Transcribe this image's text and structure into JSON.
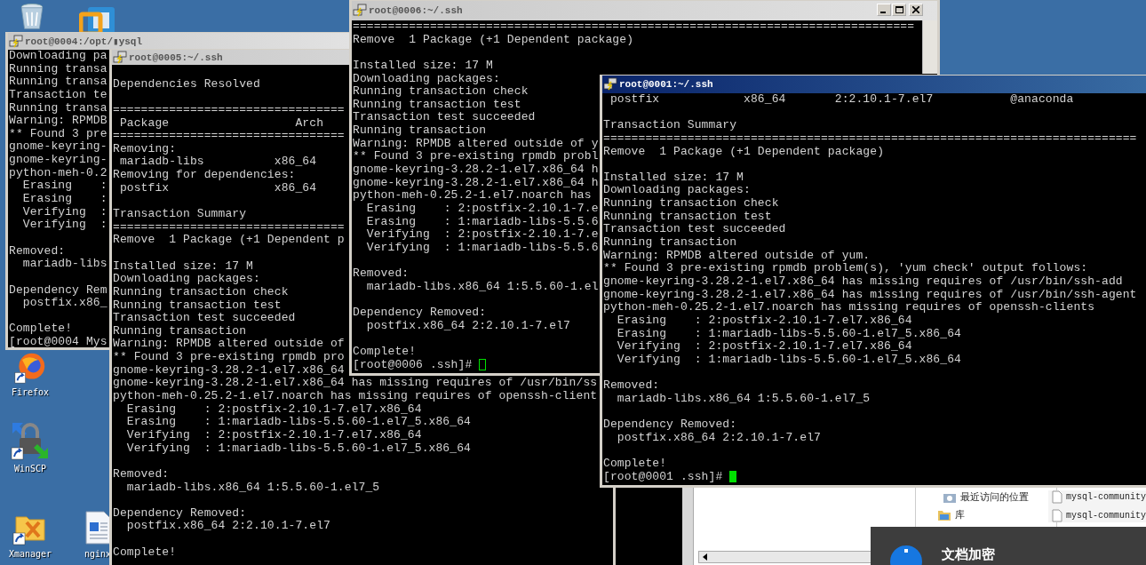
{
  "desktop_icons": [
    {
      "kind": "recycle_bin"
    },
    {
      "kind": "squares"
    },
    {
      "kind": "browser",
      "label": "Firefox"
    },
    {
      "kind": "padlock",
      "label": "WinSCP"
    },
    {
      "kind": "folder",
      "label": "Xmanager"
    },
    {
      "kind": "document",
      "label": "nginx"
    }
  ],
  "windows": [
    {
      "title": "root@0004:/opt/▮ysql",
      "active": false,
      "has_controls": false,
      "blocks": [
        [
          "Downloading pa",
          "Running transa",
          "Running transa",
          "Transaction te",
          "Running transa",
          "Warning: RPMDB",
          "** Found 3 pre",
          "gnome-keyring-",
          "gnome-keyring-",
          "python-meh-0.2",
          "  Erasing    :",
          "  Erasing    :",
          "  Verifying  :",
          "  Verifying  :"
        ],
        [
          "Removed:",
          "  mariadb-libs"
        ],
        [
          "Dependency Rem",
          "  postfix.x86_"
        ],
        [
          "Complete!",
          "[root@0004 Mys"
        ]
      ]
    },
    {
      "title": "root@0005:~/.ssh",
      "active": false,
      "blocks": [
        [
          "Dependencies Resolved"
        ],
        [
          "=================================",
          " Package                  Arch",
          "=================================",
          "Removing:",
          " mariadb-libs          x86_64",
          "Removing for dependencies:",
          " postfix               x86_64"
        ],
        [
          "Transaction Summary",
          "=================================",
          "Remove  1 Package (+1 Dependent p"
        ],
        [
          "Installed size: 17 M",
          "Downloading packages:",
          "Running transaction check",
          "Running transaction test",
          "Transaction test succeeded",
          "Running transaction",
          "Warning: RPMDB altered outside of",
          "** Found 3 pre-existing rpmdb pro",
          "gnome-keyring-3.28.2-1.el7.x86_64",
          "gnome-keyring-3.28.2-1.el7.x86_64 has missing requires of /usr/bin/ss",
          "python-meh-0.25.2-1.el7.noarch has missing requires of openssh-client",
          "  Erasing    : 2:postfix-2.10.1-7.el7.x86_64",
          "  Erasing    : 1:mariadb-libs-5.5.60-1.el7_5.x86_64",
          "  Verifying  : 2:postfix-2.10.1-7.el7.x86_64",
          "  Verifying  : 1:mariadb-libs-5.5.60-1.el7_5.x86_64"
        ],
        [
          "Removed:",
          "  mariadb-libs.x86_64 1:5.5.60-1.el7_5"
        ],
        [
          "Dependency Removed:",
          "  postfix.x86_64 2:2.10.1-7.el7"
        ],
        [
          "Complete!"
        ]
      ]
    },
    {
      "title": "root@0006:~/.ssh",
      "active": false,
      "has_controls": true,
      "cursor": true,
      "blocks": [
        [
          "================================================================================",
          "Remove  1 Package (+1 Dependent package)"
        ],
        [
          "Installed size: 17 M",
          "Downloading packages:",
          "Running transaction check",
          "Running transaction test",
          "Transaction test succeeded",
          "Running transaction",
          "Warning: RPMDB altered outside of y",
          "** Found 3 pre-existing rpmdb probl",
          "gnome-keyring-3.28.2-1.el7.x86_64 h",
          "gnome-keyring-3.28.2-1.el7.x86_64 h",
          "python-meh-0.25.2-1.el7.noarch has",
          "  Erasing    : 2:postfix-2.10.1-7.e",
          "  Erasing    : 1:mariadb-libs-5.5.6",
          "  Verifying  : 2:postfix-2.10.1-7.e",
          "  Verifying  : 1:mariadb-libs-5.5.6"
        ],
        [
          "Removed:",
          "  mariadb-libs.x86_64 1:5.5.60-1.el"
        ],
        [
          "Dependency Removed:",
          "  postfix.x86_64 2:2.10.1-7.el7"
        ],
        [
          "Complete!",
          "[root@0006 .ssh]#"
        ]
      ]
    },
    {
      "title": "root@0001:~/.ssh",
      "active": true,
      "has_controls": false,
      "cursor": true,
      "blocks": [
        [
          " postfix            x86_64       2:2.10.1-7.el7           @anaconda"
        ],
        [
          "Transaction Summary",
          "============================================================================",
          "Remove  1 Package (+1 Dependent package)"
        ],
        [
          "Installed size: 17 M",
          "Downloading packages:",
          "Running transaction check",
          "Running transaction test",
          "Transaction test succeeded",
          "Running transaction",
          "Warning: RPMDB altered outside of yum.",
          "** Found 3 pre-existing rpmdb problem(s), 'yum check' output follows:",
          "gnome-keyring-3.28.2-1.el7.x86_64 has missing requires of /usr/bin/ssh-add",
          "gnome-keyring-3.28.2-1.el7.x86_64 has missing requires of /usr/bin/ssh-agent",
          "python-meh-0.25.2-1.el7.noarch has missing requires of openssh-clients",
          "  Erasing    : 2:postfix-2.10.1-7.el7.x86_64",
          "  Erasing    : 1:mariadb-libs-5.5.60-1.el7_5.x86_64",
          "  Verifying  : 2:postfix-2.10.1-7.el7.x86_64",
          "  Verifying  : 1:mariadb-libs-5.5.60-1.el7_5.x86_64"
        ],
        [
          "Removed:",
          "  mariadb-libs.x86_64 1:5.5.60-1.el7_5"
        ],
        [
          "Dependency Removed:",
          "  postfix.x86_64 2:2.10.1-7.el7"
        ],
        [
          "Complete!",
          "[root@0001 .ssh]#"
        ]
      ]
    }
  ],
  "explorer": {
    "nav_items": [
      {
        "label": "最近访问的位置",
        "kind": "recent"
      },
      {
        "label": "库",
        "kind": "library"
      }
    ],
    "files": [
      "mysql-community",
      "mysql-community"
    ]
  },
  "notification": {
    "title": "文档加密"
  }
}
